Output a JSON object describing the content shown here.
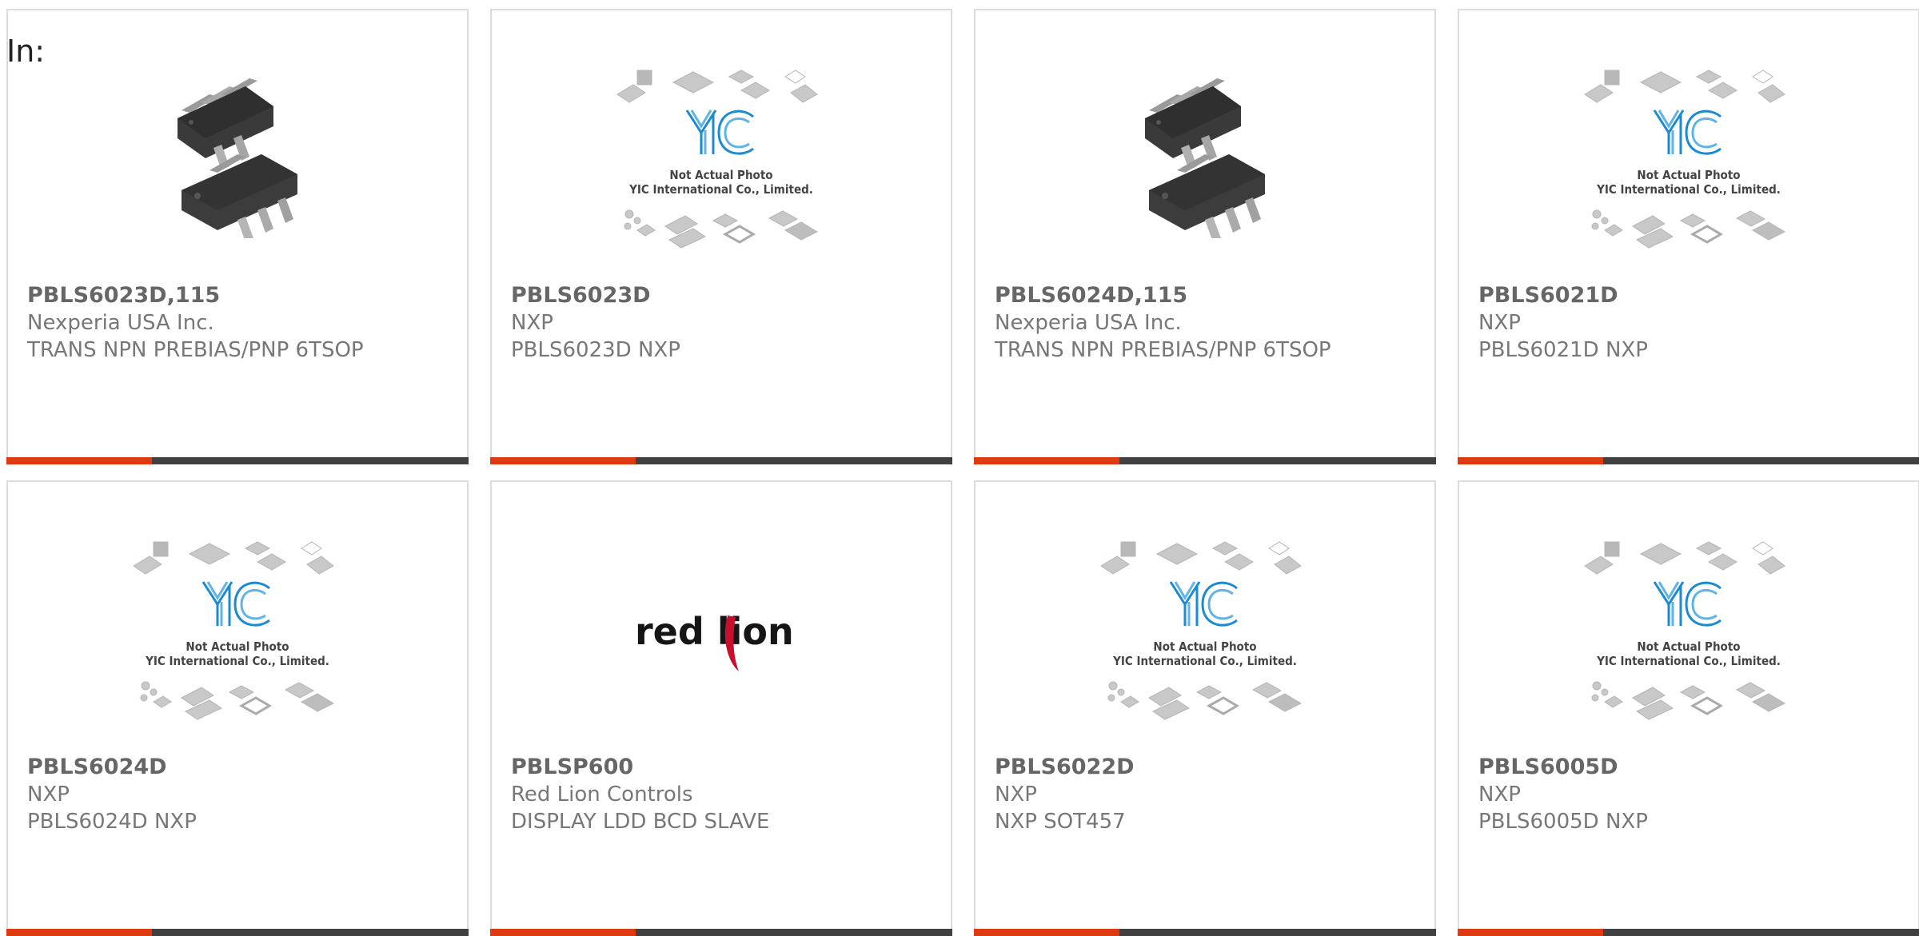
{
  "filter_label": "In:",
  "placeholder_caption": {
    "line1": "Not Actual Photo",
    "line2": "YIC International Co., Limited."
  },
  "logo_text": {
    "yic": "YIC",
    "redlion": "red lion"
  },
  "colors": {
    "accent_bar": "#de3a12",
    "dark_bar": "#404040",
    "yic_blue": "#1a8ad3"
  },
  "products": [
    {
      "part_number": "PBLS6023D,115",
      "manufacturer": "Nexperia USA Inc.",
      "description": "TRANS NPN PREBIAS/PNP 6TSOP",
      "image": "sot-chip-photo"
    },
    {
      "part_number": "PBLS6023D",
      "manufacturer": "NXP",
      "description": "PBLS6023D NXP",
      "image": "yic-placeholder"
    },
    {
      "part_number": "PBLS6024D,115",
      "manufacturer": "Nexperia USA Inc.",
      "description": "TRANS NPN PREBIAS/PNP 6TSOP",
      "image": "sot-chip-photo"
    },
    {
      "part_number": "PBLS6021D",
      "manufacturer": "NXP",
      "description": "PBLS6021D NXP",
      "image": "yic-placeholder"
    },
    {
      "part_number": "PBLS6024D",
      "manufacturer": "NXP",
      "description": "PBLS6024D NXP",
      "image": "yic-placeholder"
    },
    {
      "part_number": "PBLSP600",
      "manufacturer": "Red Lion Controls",
      "description": "DISPLAY LDD BCD SLAVE",
      "image": "red-lion-logo"
    },
    {
      "part_number": "PBLS6022D",
      "manufacturer": "NXP",
      "description": "NXP SOT457",
      "image": "yic-placeholder"
    },
    {
      "part_number": "PBLS6005D",
      "manufacturer": "NXP",
      "description": "PBLS6005D NXP",
      "image": "yic-placeholder"
    }
  ]
}
